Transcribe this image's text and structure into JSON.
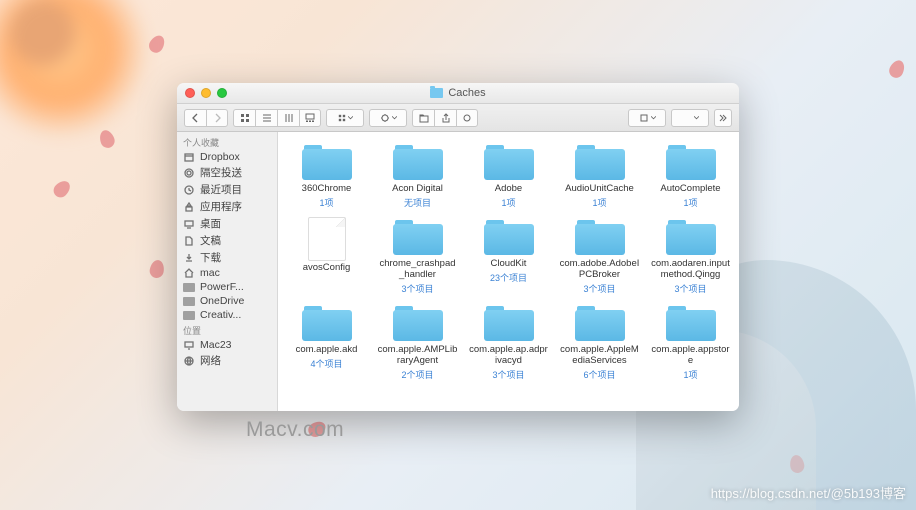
{
  "window": {
    "title": "Caches"
  },
  "sidebar": {
    "favorites_header": "个人收藏",
    "locations_header": "位置",
    "favorites": [
      {
        "label": "Dropbox",
        "icon": "box"
      },
      {
        "label": "隔空投送",
        "icon": "airdrop"
      },
      {
        "label": "最近项目",
        "icon": "clock"
      },
      {
        "label": "应用程序",
        "icon": "apps"
      },
      {
        "label": "桌面",
        "icon": "desktop"
      },
      {
        "label": "文稿",
        "icon": "doc"
      },
      {
        "label": "下载",
        "icon": "download"
      },
      {
        "label": "mac",
        "icon": "home"
      },
      {
        "label": "PowerF...",
        "icon": "folder"
      },
      {
        "label": "OneDrive",
        "icon": "folder"
      },
      {
        "label": "Creativ...",
        "icon": "folder"
      }
    ],
    "locations": [
      {
        "label": "Mac23",
        "icon": "computer"
      },
      {
        "label": "网络",
        "icon": "net"
      }
    ]
  },
  "items": [
    {
      "name": "360Chrome",
      "sub": "1项",
      "type": "folder"
    },
    {
      "name": "Acon Digital",
      "sub": "无项目",
      "type": "folder"
    },
    {
      "name": "Adobe",
      "sub": "1项",
      "type": "folder"
    },
    {
      "name": "AudioUnitCache",
      "sub": "1项",
      "type": "folder"
    },
    {
      "name": "AutoComplete",
      "sub": "1项",
      "type": "folder"
    },
    {
      "name": "avosConfig",
      "sub": "",
      "type": "file"
    },
    {
      "name": "chrome_crashpad_handler",
      "sub": "3个项目",
      "type": "folder"
    },
    {
      "name": "CloudKit",
      "sub": "23个项目",
      "type": "folder"
    },
    {
      "name": "com.adobe.AdobeIPCBroker",
      "sub": "3个项目",
      "type": "folder"
    },
    {
      "name": "com.aodaren.inputmethod.Qingg",
      "sub": "3个项目",
      "type": "folder"
    },
    {
      "name": "com.apple.akd",
      "sub": "4个项目",
      "type": "folder"
    },
    {
      "name": "com.apple.AMPLibraryAgent",
      "sub": "2个项目",
      "type": "folder"
    },
    {
      "name": "com.apple.ap.adprivacyd",
      "sub": "3个项目",
      "type": "folder"
    },
    {
      "name": "com.apple.AppleMediaServices",
      "sub": "6个项目",
      "type": "folder"
    },
    {
      "name": "com.apple.appstore",
      "sub": "1项",
      "type": "folder"
    }
  ],
  "watermarks": {
    "center": "Macv.com",
    "br": "https://blog.csdn.net/@5b193博客"
  }
}
